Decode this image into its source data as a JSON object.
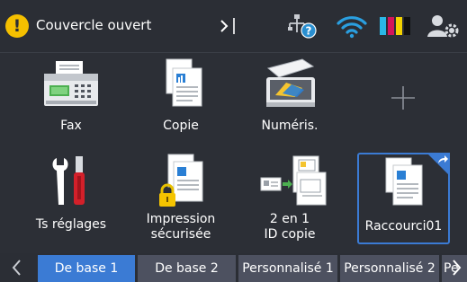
{
  "status": {
    "message": "Couvercle ouvert",
    "warning_symbol": "!",
    "warning_color": "#f5c000"
  },
  "icons": {
    "more": "chevron-right-bar-icon",
    "network": "wired-network-help-icon",
    "wifi": "wifi-icon",
    "ink": "ink-cartridges-icon",
    "user": "user-settings-icon"
  },
  "ink_colors": [
    "#2ab7e6",
    "#d4145a",
    "#f4d300",
    "#111111"
  ],
  "accent_color": "#3b7bd4",
  "tiles": [
    {
      "label": "Fax",
      "icon": "fax-icon"
    },
    {
      "label": "Copie",
      "icon": "copy-icon"
    },
    {
      "label": "Numéris.",
      "icon": "scanner-icon"
    },
    {
      "label": "",
      "icon": "add-shortcut-plus-icon"
    },
    {
      "label": "Ts réglages",
      "icon": "tools-settings-icon"
    },
    {
      "label_line1": "Impression",
      "label_line2": "sécurisée",
      "icon": "secure-print-lock-icon"
    },
    {
      "label_line1": "2 en 1",
      "label_line2": "ID copie",
      "icon": "two-in-one-id-copy-icon"
    },
    {
      "label": "Raccourci01",
      "icon": "shortcut-document-icon"
    }
  ],
  "tabs": [
    {
      "label": "De base 1",
      "active": true
    },
    {
      "label": "De base 2",
      "active": false
    },
    {
      "label": "Personnalisé 1",
      "active": false
    },
    {
      "label": "Personnalisé 2",
      "active": false
    },
    {
      "label": "Pe",
      "active": false
    }
  ]
}
